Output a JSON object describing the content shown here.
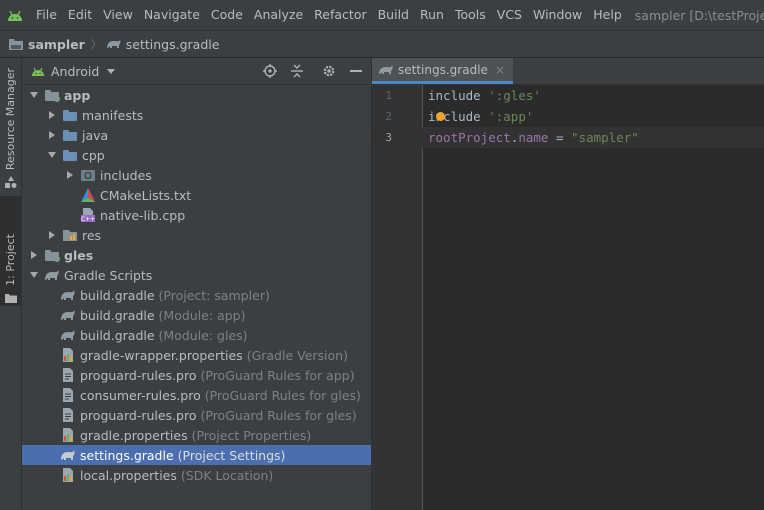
{
  "window": {
    "title": "sampler [D:\\testProject\\graphi"
  },
  "menu": {
    "items": [
      "File",
      "Edit",
      "View",
      "Navigate",
      "Code",
      "Analyze",
      "Refactor",
      "Build",
      "Run",
      "Tools",
      "VCS",
      "Window",
      "Help"
    ]
  },
  "breadcrumb": {
    "project": "sampler",
    "file": "settings.gradle"
  },
  "toolstrip": {
    "tabs": [
      "Resource Manager",
      "1: Project"
    ]
  },
  "project_panel": {
    "view_mode": "Android",
    "tree": [
      {
        "name": "app",
        "hint": "",
        "level": 0,
        "expanded": true,
        "icon": "module-folder-icon",
        "bold": true
      },
      {
        "name": "manifests",
        "hint": "",
        "level": 1,
        "expanded": false,
        "icon": "folder-icon"
      },
      {
        "name": "java",
        "hint": "",
        "level": 1,
        "expanded": false,
        "icon": "folder-icon"
      },
      {
        "name": "cpp",
        "hint": "",
        "level": 1,
        "expanded": true,
        "icon": "folder-icon"
      },
      {
        "name": "includes",
        "hint": "",
        "level": 2,
        "expanded": false,
        "icon": "include-folder-icon"
      },
      {
        "name": "CMakeLists.txt",
        "hint": "",
        "level": 2,
        "expanded": null,
        "icon": "cmake-icon"
      },
      {
        "name": "native-lib.cpp",
        "hint": "",
        "level": 2,
        "expanded": null,
        "icon": "cpp-file-icon"
      },
      {
        "name": "res",
        "hint": "",
        "level": 1,
        "expanded": false,
        "icon": "res-folder-icon"
      },
      {
        "name": "gles",
        "hint": "",
        "level": 0,
        "expanded": false,
        "icon": "module-folder-icon",
        "bold": true
      },
      {
        "name": "Gradle Scripts",
        "hint": "",
        "level": 0,
        "expanded": true,
        "icon": "gradle-icon"
      },
      {
        "name": "build.gradle",
        "hint": "(Project: sampler)",
        "level": 1,
        "expanded": null,
        "icon": "gradle-icon"
      },
      {
        "name": "build.gradle",
        "hint": "(Module: app)",
        "level": 1,
        "expanded": null,
        "icon": "gradle-icon"
      },
      {
        "name": "build.gradle",
        "hint": "(Module: gles)",
        "level": 1,
        "expanded": null,
        "icon": "gradle-icon"
      },
      {
        "name": "gradle-wrapper.properties",
        "hint": "(Gradle Version)",
        "level": 1,
        "expanded": null,
        "icon": "properties-icon"
      },
      {
        "name": "proguard-rules.pro",
        "hint": "(ProGuard Rules for app)",
        "level": 1,
        "expanded": null,
        "icon": "text-file-icon"
      },
      {
        "name": "consumer-rules.pro",
        "hint": "(ProGuard Rules for gles)",
        "level": 1,
        "expanded": null,
        "icon": "text-file-icon"
      },
      {
        "name": "proguard-rules.pro",
        "hint": "(ProGuard Rules for gles)",
        "level": 1,
        "expanded": null,
        "icon": "text-file-icon"
      },
      {
        "name": "gradle.properties",
        "hint": "(Project Properties)",
        "level": 1,
        "expanded": null,
        "icon": "properties-icon"
      },
      {
        "name": "settings.gradle",
        "hint": "(Project Settings)",
        "level": 1,
        "expanded": null,
        "icon": "gradle-icon",
        "selected": true
      },
      {
        "name": "local.properties",
        "hint": "(SDK Location)",
        "level": 1,
        "expanded": null,
        "icon": "properties-icon"
      }
    ]
  },
  "editor": {
    "tab_label": "settings.gradle",
    "current_line": 3,
    "lines": [
      {
        "number": "1",
        "tokens": [
          {
            "t": "include ",
            "c": "kw"
          },
          {
            "t": "':gles'",
            "c": "str"
          }
        ]
      },
      {
        "number": "2",
        "tokens": [
          {
            "t": "include ",
            "c": "kw"
          },
          {
            "t": "':app'",
            "c": "str"
          }
        ]
      },
      {
        "number": "3",
        "tokens": [
          {
            "t": "rootProject",
            "c": "id"
          },
          {
            "t": ".",
            "c": "op"
          },
          {
            "t": "name",
            "c": "id"
          },
          {
            "t": " = ",
            "c": "op"
          },
          {
            "t": "\"sampler\"",
            "c": "str"
          }
        ]
      }
    ]
  },
  "colors": {
    "selection": "#4b6eaf",
    "accent_tab": "#4a88c7",
    "string": "#6a8759",
    "identifier": "#9876aa"
  }
}
